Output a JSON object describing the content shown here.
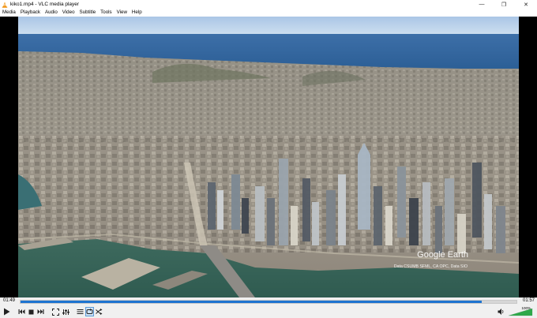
{
  "window": {
    "title": "kiko1.mp4 - VLC media player",
    "controls": {
      "minimize": "—",
      "maximize": "❐",
      "close": "✕"
    }
  },
  "menu": {
    "items": [
      {
        "label": "Media"
      },
      {
        "label": "Playback"
      },
      {
        "label": "Audio"
      },
      {
        "label": "Video"
      },
      {
        "label": "Subtitle"
      },
      {
        "label": "Tools"
      },
      {
        "label": "View"
      },
      {
        "label": "Help"
      }
    ]
  },
  "video": {
    "watermark": "Google Earth",
    "credits": "Data CSUMB SFML, CA OPC, Data SIO"
  },
  "playback": {
    "elapsed": "01:49",
    "total": "01:57",
    "progress": 0.93
  },
  "volume": {
    "label": "100%",
    "level": 1.0
  },
  "buttons": {
    "play": "play-icon",
    "previous": "previous-icon",
    "stop": "stop-icon",
    "next": "next-icon",
    "fullscreen": "fullscreen-icon",
    "extended_settings": "equalizer-icon",
    "playlist": "playlist-icon",
    "loop": "loop-icon",
    "shuffle": "shuffle-icon",
    "mute": "speaker-icon"
  },
  "colors": {
    "accent": "#1e74d0",
    "volume": "#2ea84a",
    "vlc_orange": "#f08c00"
  }
}
